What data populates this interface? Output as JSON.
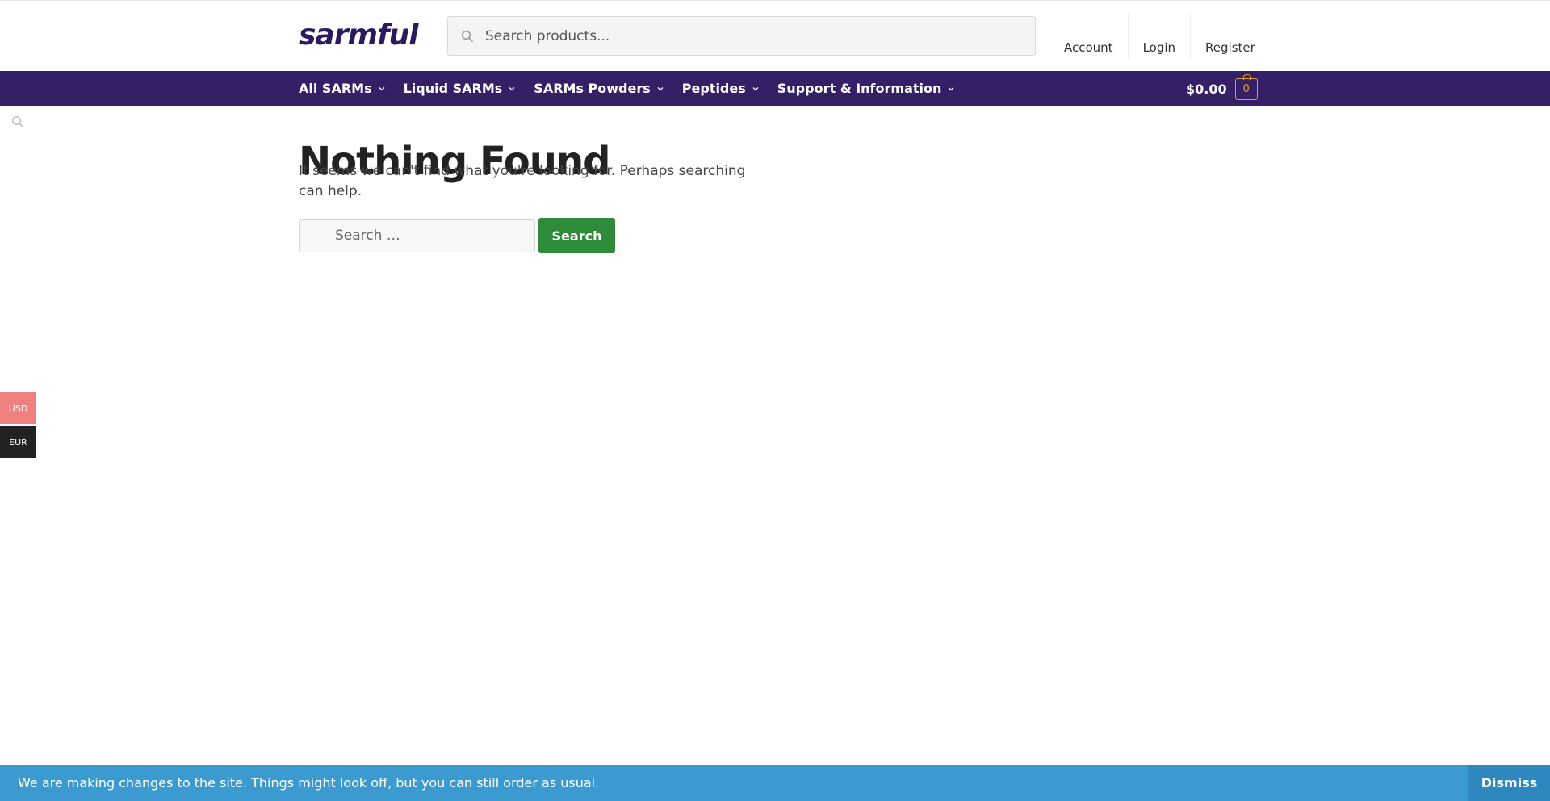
{
  "header": {
    "logo": "sarmful",
    "search_placeholder": "Search products...",
    "account_links": [
      "Account",
      "Login",
      "Register"
    ]
  },
  "nav": {
    "items": [
      {
        "label": "All SARMs"
      },
      {
        "label": "Liquid SARMs"
      },
      {
        "label": "SARMs Powders"
      },
      {
        "label": "Peptides"
      },
      {
        "label": "Support & Information"
      }
    ],
    "cart_total": "$0.00",
    "cart_count": "0"
  },
  "main": {
    "title": "Nothing Found",
    "description": "It seems we can't find what you're looking for. Perhaps searching can help.",
    "search_placeholder": "Search …",
    "search_button": "Search"
  },
  "currency": {
    "options": [
      "USD",
      "EUR"
    ]
  },
  "notice": {
    "message": "We are making changes to the site. Things might look off, but you can still order as usual.",
    "dismiss": "Dismiss"
  },
  "colors": {
    "nav_bg": "#351f66",
    "logo": "#2b1b5e",
    "search_button": "#2e8b3a",
    "notice_bg": "#3b9bd1",
    "cart_accent": "#e0a02c",
    "usd_bg": "#f08080",
    "eur_bg": "#222222"
  }
}
